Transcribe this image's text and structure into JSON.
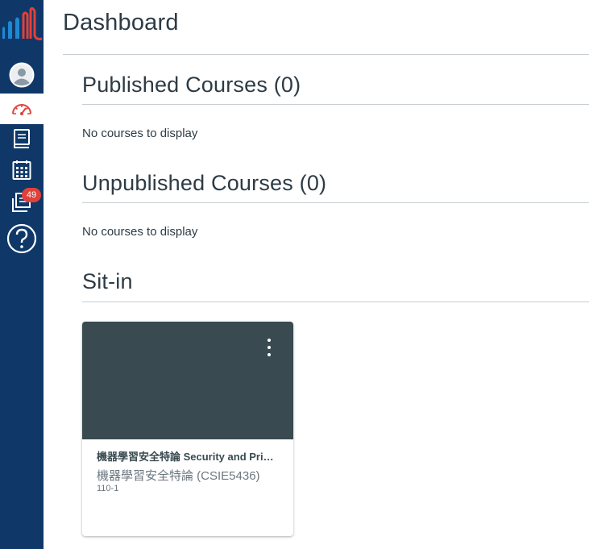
{
  "global_nav": {
    "logo_alt": "Canvas",
    "items": [
      {
        "name": "account",
        "icon": "user-avatar-icon"
      },
      {
        "name": "dashboard",
        "icon": "speedometer-icon",
        "active": true
      },
      {
        "name": "courses",
        "icon": "book-icon"
      },
      {
        "name": "calendar",
        "icon": "calendar-icon"
      },
      {
        "name": "inbox",
        "icon": "inbox-icon",
        "badge": "49"
      },
      {
        "name": "help",
        "icon": "question-circle-icon"
      }
    ],
    "colors": {
      "background": "#0f3868",
      "active_accent": "#e0413a",
      "badge": "#e0413a"
    }
  },
  "page": {
    "title": "Dashboard"
  },
  "sections": {
    "published": {
      "heading": "Published Courses (0)",
      "empty_text": "No courses to display"
    },
    "unpublished": {
      "heading": "Unpublished Courses (0)",
      "empty_text": "No courses to display"
    },
    "sit_in": {
      "heading": "Sit-in"
    }
  },
  "course_card": {
    "name": "機器學習安全特論 Security and Pri…",
    "code": "機器學習安全特論 (CSIE5436)",
    "term": "110-1",
    "hero_color": "#394b50",
    "menu_icon": "kebab-vertical-icon"
  }
}
